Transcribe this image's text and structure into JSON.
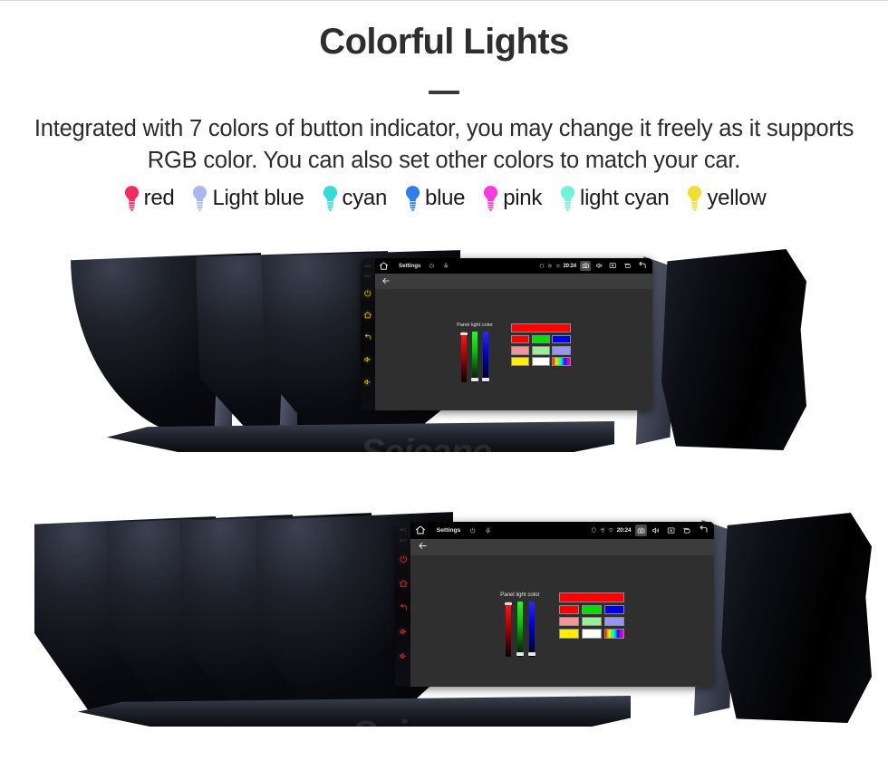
{
  "header": {
    "title": "Colorful Lights",
    "subtitle": "Integrated with 7 colors of button indicator, you may change it freely as it supports RGB color. You can also set other colors to match your car."
  },
  "legend": {
    "items": [
      {
        "label": "red",
        "color": "#f72a5e",
        "icon": "bulb-icon"
      },
      {
        "label": "Light blue",
        "color": "#a9b8f5",
        "icon": "bulb-icon"
      },
      {
        "label": "cyan",
        "color": "#34dcd6",
        "icon": "bulb-icon"
      },
      {
        "label": "blue",
        "color": "#2f7fe8",
        "icon": "bulb-icon"
      },
      {
        "label": "pink",
        "color": "#f73ae0",
        "icon": "bulb-icon"
      },
      {
        "label": "light cyan",
        "color": "#6ff3d8",
        "icon": "bulb-icon"
      },
      {
        "label": "yellow",
        "color": "#f2dd35",
        "icon": "bulb-icon"
      }
    ]
  },
  "units": [
    {
      "id": "top",
      "button_glow_color": "#e8c21a",
      "watermark": "Seicane",
      "screen": {
        "statusbar": {
          "home_icon": "home-icon",
          "title": "Settings",
          "left_icons": [
            "power-icon",
            "mic-icon"
          ],
          "status_icons": [
            "shield-icon",
            "location-icon",
            "wifi-icon"
          ],
          "time": "20:24",
          "buttons": [
            {
              "name": "camera-icon",
              "active": true
            },
            {
              "name": "volume-icon",
              "active": false
            },
            {
              "name": "screenshot-icon",
              "active": false
            },
            {
              "name": "recents-icon",
              "active": false
            },
            {
              "name": "back-icon",
              "active": false
            }
          ]
        },
        "actionbar": {
          "back_icon": "arrow-back-icon"
        },
        "panel": {
          "label": "Panel light color",
          "sliders": [
            {
              "name": "red-slider",
              "channel": "R",
              "thumb_position": "top"
            },
            {
              "name": "green-slider",
              "channel": "G",
              "thumb_position": "bottom"
            },
            {
              "name": "blue-slider",
              "channel": "B",
              "thumb_position": "bottom"
            }
          ],
          "preview_color": "#ff0000",
          "swatch_rows": [
            [
              "#ff0000",
              "#00e000",
              "#0000e6"
            ],
            [
              "#f79393",
              "#97ef97",
              "#9696f2"
            ],
            [
              "#ffee00",
              "#ffffff",
              "rainbow"
            ]
          ]
        }
      }
    },
    {
      "id": "bottom",
      "button_glow_color": "#d8342a",
      "watermark": "Seicane",
      "screen": {
        "statusbar": {
          "home_icon": "home-icon",
          "title": "Settings",
          "left_icons": [
            "power-icon",
            "mic-icon"
          ],
          "status_icons": [
            "shield-icon",
            "location-icon",
            "wifi-icon"
          ],
          "time": "20:24",
          "buttons": [
            {
              "name": "camera-icon",
              "active": true
            },
            {
              "name": "volume-icon",
              "active": false
            },
            {
              "name": "screenshot-icon",
              "active": false
            },
            {
              "name": "recents-icon",
              "active": false
            },
            {
              "name": "back-icon",
              "active": false
            }
          ]
        },
        "actionbar": {
          "back_icon": "arrow-back-icon"
        },
        "panel": {
          "label": "Panel light color",
          "sliders": [
            {
              "name": "red-slider",
              "channel": "R",
              "thumb_position": "top"
            },
            {
              "name": "green-slider",
              "channel": "G",
              "thumb_position": "bottom"
            },
            {
              "name": "blue-slider",
              "channel": "B",
              "thumb_position": "bottom"
            }
          ],
          "preview_color": "#ff0000",
          "swatch_rows": [
            [
              "#ff0000",
              "#00e000",
              "#0000e6"
            ],
            [
              "#f79393",
              "#97ef97",
              "#9696f2"
            ],
            [
              "#ffee00",
              "#ffffff",
              "rainbow"
            ]
          ]
        }
      }
    }
  ],
  "keystrip_labels": [
    "MIC",
    "RST"
  ]
}
